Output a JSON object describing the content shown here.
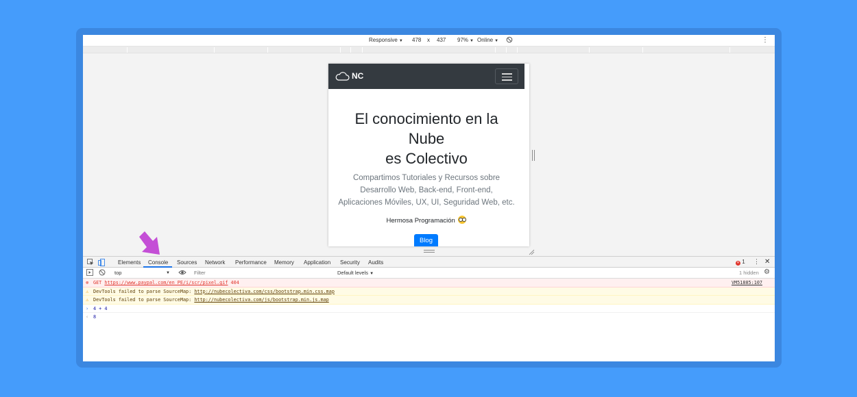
{
  "device_toolbar": {
    "mode": "Responsive",
    "width": "478",
    "times": "x",
    "height": "437",
    "zoom": "97%",
    "throttle": "Online"
  },
  "page": {
    "brand": "NC",
    "hero_line1": "El conocimiento en la",
    "hero_line2": "Nube",
    "hero_line3": "es Colectivo",
    "lead_line1": "Compartimos Tutoriales y Recursos sobre",
    "lead_line2": "Desarrollo Web, Back-end, Front-end,",
    "lead_line3": "Aplicaciones Móviles, UX, UI, Seguridad Web, etc.",
    "tagline": "Hermosa Programación",
    "blog_button": "Blog"
  },
  "devtools": {
    "tabs": [
      "Elements",
      "Console",
      "Sources",
      "Network",
      "Performance",
      "Memory",
      "Application",
      "Security",
      "Audits"
    ],
    "active_tab": "Console",
    "error_count": "1",
    "context": "top",
    "filter_placeholder": "Filter",
    "levels": "Default levels",
    "hidden": "1 hidden"
  },
  "console": {
    "error": {
      "prefix": "GET ",
      "url": "https://www.paypal.com/en_PE/i/scr/pixel.gif",
      "status": "404",
      "source": "VM51885:107"
    },
    "warn1": {
      "text": "DevTools failed to parse SourceMap: ",
      "url": "http://nubecolectiva.com/css/bootstrap.min.css.map"
    },
    "warn2": {
      "text": "DevTools failed to parse SourceMap: ",
      "url": "http://nubecolectiva.com/js/bootstrap.min.js.map"
    },
    "input": "4 + 4",
    "result": "8"
  },
  "colors": {
    "background": "#459cfb",
    "navbar": "#343a40",
    "primary": "#007bff",
    "arrow": "#c44fd6"
  }
}
